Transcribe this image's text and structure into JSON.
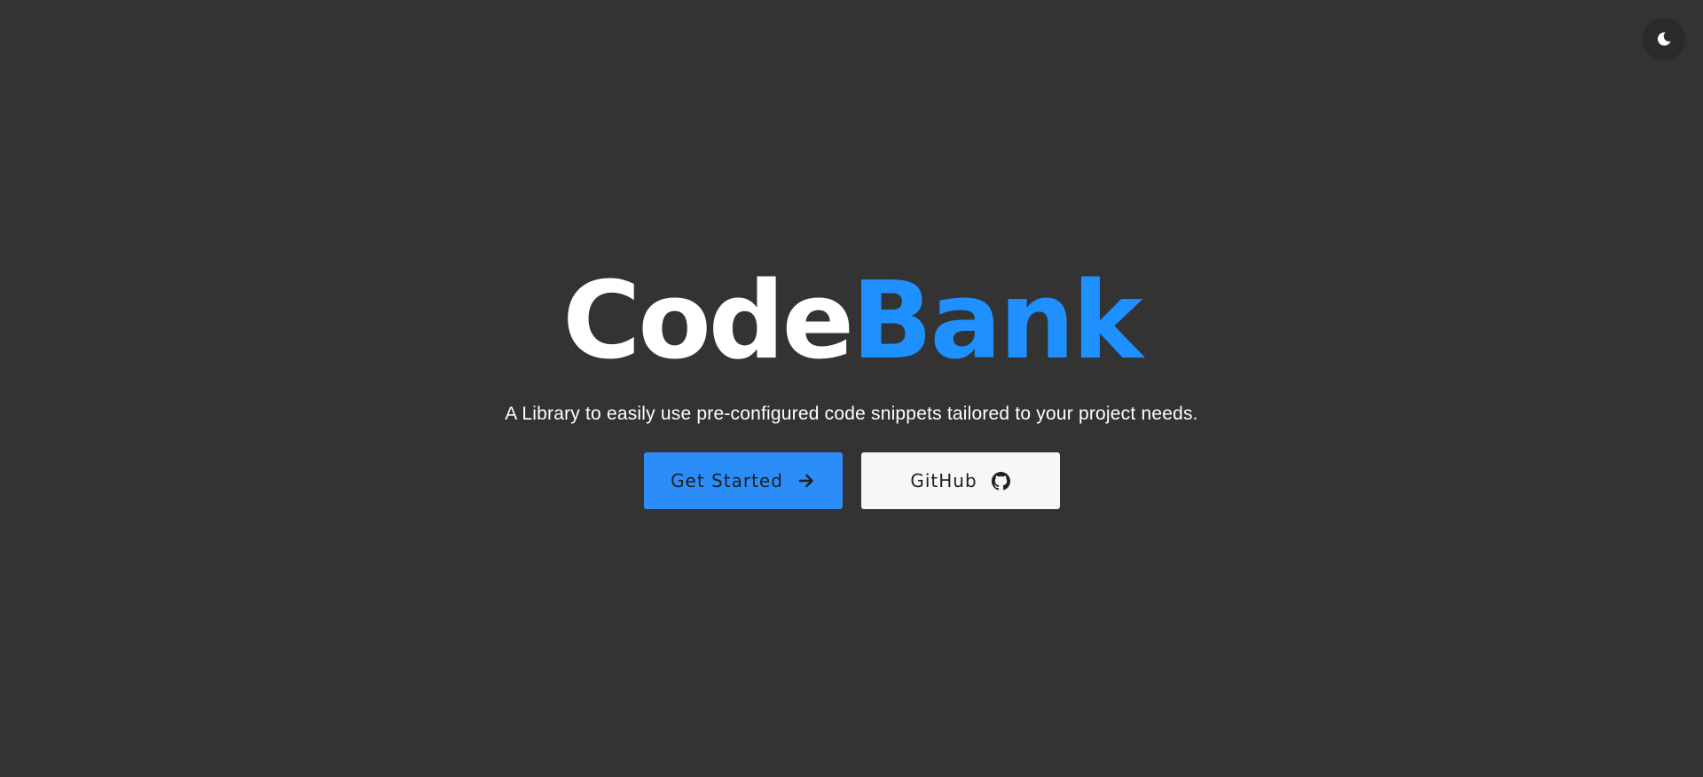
{
  "header": {
    "theme_toggle_icon": "moon-icon"
  },
  "hero": {
    "brand_part1": "Code",
    "brand_part2": "Bank",
    "tagline": "A Library to easily use pre-configured code snippets tailored to your project needs."
  },
  "actions": {
    "primary_label": "Get Started",
    "primary_icon": "arrow-right-icon",
    "secondary_label": "GitHub",
    "secondary_icon": "github-icon"
  },
  "colors": {
    "background": "#333333",
    "brand_accent": "#1e90ff",
    "primary_button": "#2b8ef8",
    "secondary_button": "#f7f7f7"
  }
}
